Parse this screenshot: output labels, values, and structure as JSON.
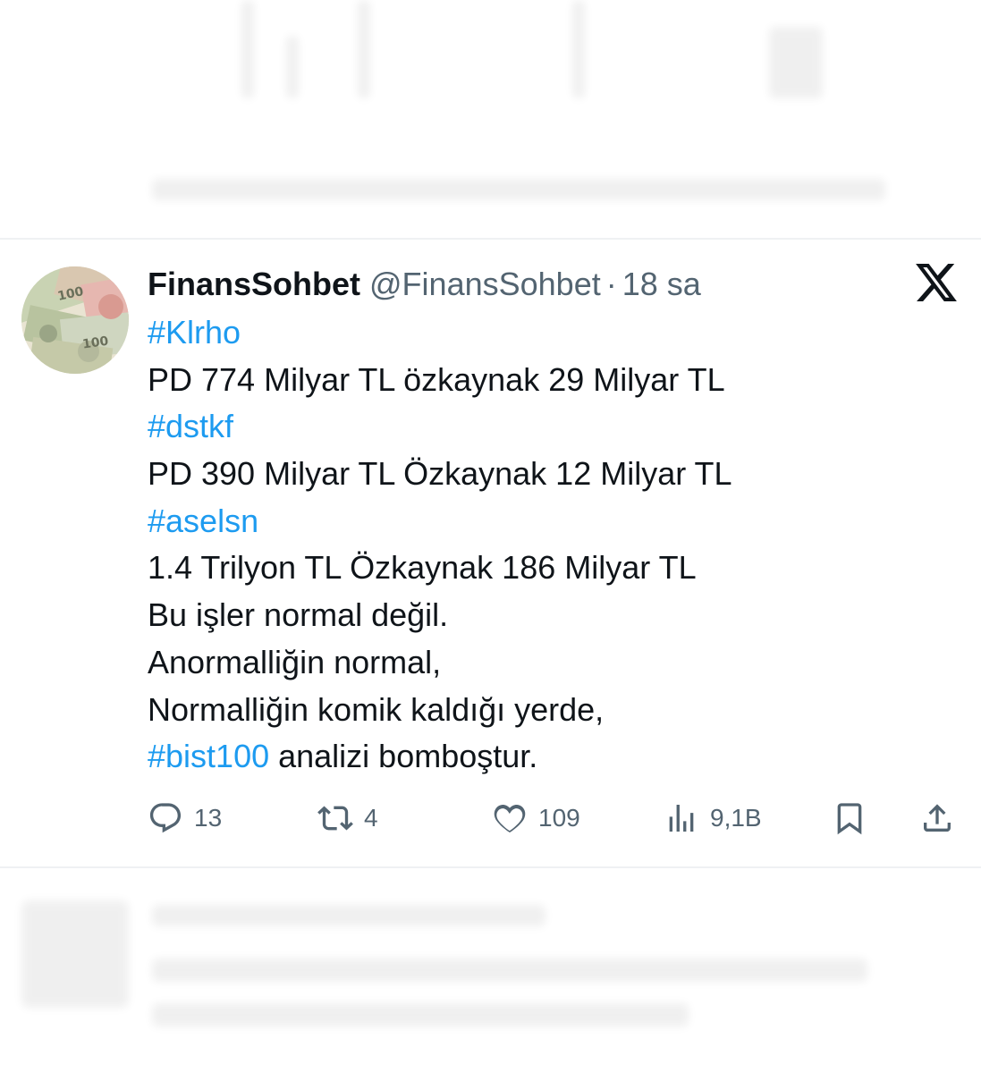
{
  "tweet": {
    "display_name": "FinansSohbet",
    "handle": "@FinansSohbet",
    "separator": "·",
    "time": "18 sa",
    "lines": [
      {
        "type": "hashtag",
        "text": "#Klrho"
      },
      {
        "type": "text",
        "text": "PD 774 Milyar TL özkaynak 29 Milyar TL"
      },
      {
        "type": "hashtag",
        "text": "#dstkf"
      },
      {
        "type": "text",
        "text": "PD 390 Milyar TL Özkaynak 12 Milyar TL"
      },
      {
        "type": "hashtag",
        "text": "#aselsn"
      },
      {
        "type": "text",
        "text": "1.4 Trilyon TL Özkaynak 186 Milyar TL"
      },
      {
        "type": "text",
        "text": "Bu işler normal değil."
      },
      {
        "type": "text",
        "text": "Anormalliğin normal,"
      },
      {
        "type": "text",
        "text": "Normalliğin komik kaldığı yerde,"
      },
      {
        "type": "mixed",
        "hashtag": "#bist100",
        "text": " analizi bomboştur."
      }
    ]
  },
  "actions": {
    "replies": "13",
    "retweets": "4",
    "likes": "109",
    "views": "9,1B"
  },
  "icons": {
    "platform": "x-logo-icon",
    "reply": "reply-icon",
    "retweet": "retweet-icon",
    "like": "heart-icon",
    "views": "views-icon",
    "bookmark": "bookmark-icon",
    "share": "share-icon"
  },
  "colors": {
    "text": "#0f1419",
    "secondary": "#536471",
    "hashtag": "#1d9bf0",
    "divider": "#eff1f3"
  }
}
